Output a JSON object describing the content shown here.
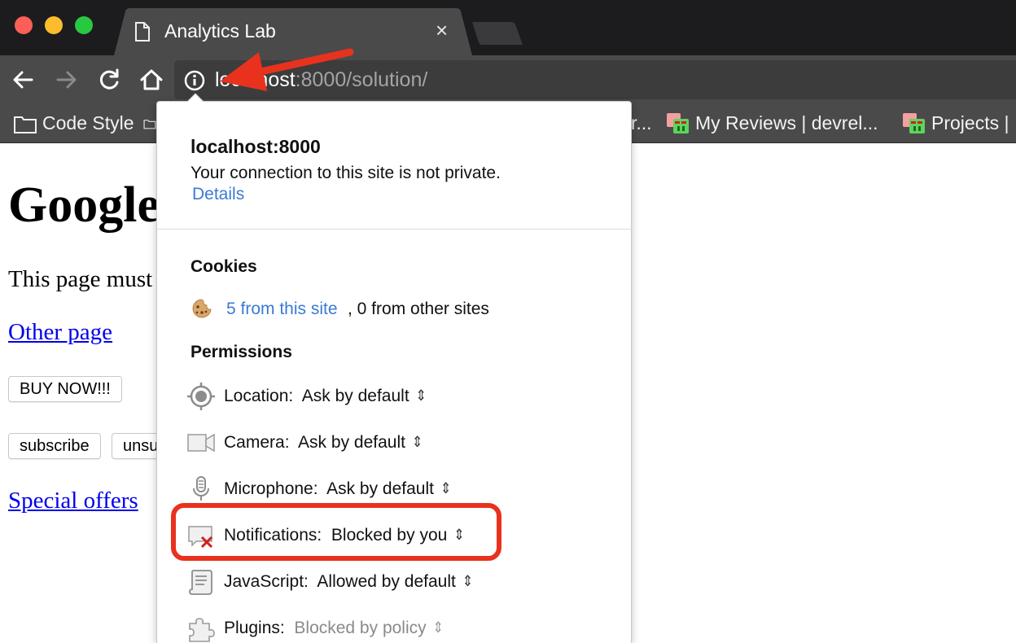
{
  "window": {
    "tab_title": "Analytics Lab",
    "tab_close_glyph": "×",
    "traffic_lights": {
      "close": "#fc5f57",
      "minimize": "#fdbc2e",
      "maximize": "#28c840"
    }
  },
  "toolbar": {
    "back_icon": "arrow-left-icon",
    "forward_icon": "arrow-right-icon",
    "reload_icon": "reload-icon",
    "home_icon": "home-icon",
    "site_info_icon": "info-circle-icon",
    "url_host": "localhost",
    "url_path": ":8000/solution/"
  },
  "bookmarks": [
    {
      "label": "Code Style",
      "icon": "folder-icon"
    },
    {
      "label": "",
      "icon": "folder-icon"
    },
    {
      "label": "r..."
    },
    {
      "label": "My Reviews | devrel...",
      "icon": "gerrit-icon"
    },
    {
      "label": "Projects |",
      "icon": "gerrit-icon"
    }
  ],
  "page": {
    "heading": "Google",
    "paragraph": "This page must",
    "link_other": "Other page",
    "button_buy": "BUY NOW!!!",
    "button_subscribe": "subscribe",
    "button_unsubscribe": "unsu",
    "link_special": "Special offers"
  },
  "site_info": {
    "host": "localhost:8000",
    "message": "Your connection to this site is not private.",
    "details_link": "Details",
    "cookies_title": "Cookies",
    "cookies_link": "5 from this site",
    "cookies_rest": ", 0 from other sites",
    "permissions_title": "Permissions",
    "permissions": [
      {
        "label": "Location:",
        "value": "Ask by default",
        "icon": "location-crosshair-icon"
      },
      {
        "label": "Camera:",
        "value": "Ask by default",
        "icon": "camera-icon"
      },
      {
        "label": "Microphone:",
        "value": "Ask by default",
        "icon": "microphone-icon"
      },
      {
        "label": "Notifications:",
        "value": "Blocked by you",
        "icon": "notifications-blocked-icon"
      },
      {
        "label": "JavaScript:",
        "value": "Allowed by default",
        "icon": "javascript-scroll-icon"
      },
      {
        "label": "Plugins:",
        "value": "Blocked by policy",
        "icon": "plugin-puzzle-icon",
        "disabled": true
      }
    ],
    "updown_glyph": "⇕"
  },
  "colors": {
    "link_blue": "#3a7ad4",
    "annotation_red": "#e8321e",
    "toolbar": "#4a4a4a",
    "tabstrip": "#1c1c1e"
  }
}
